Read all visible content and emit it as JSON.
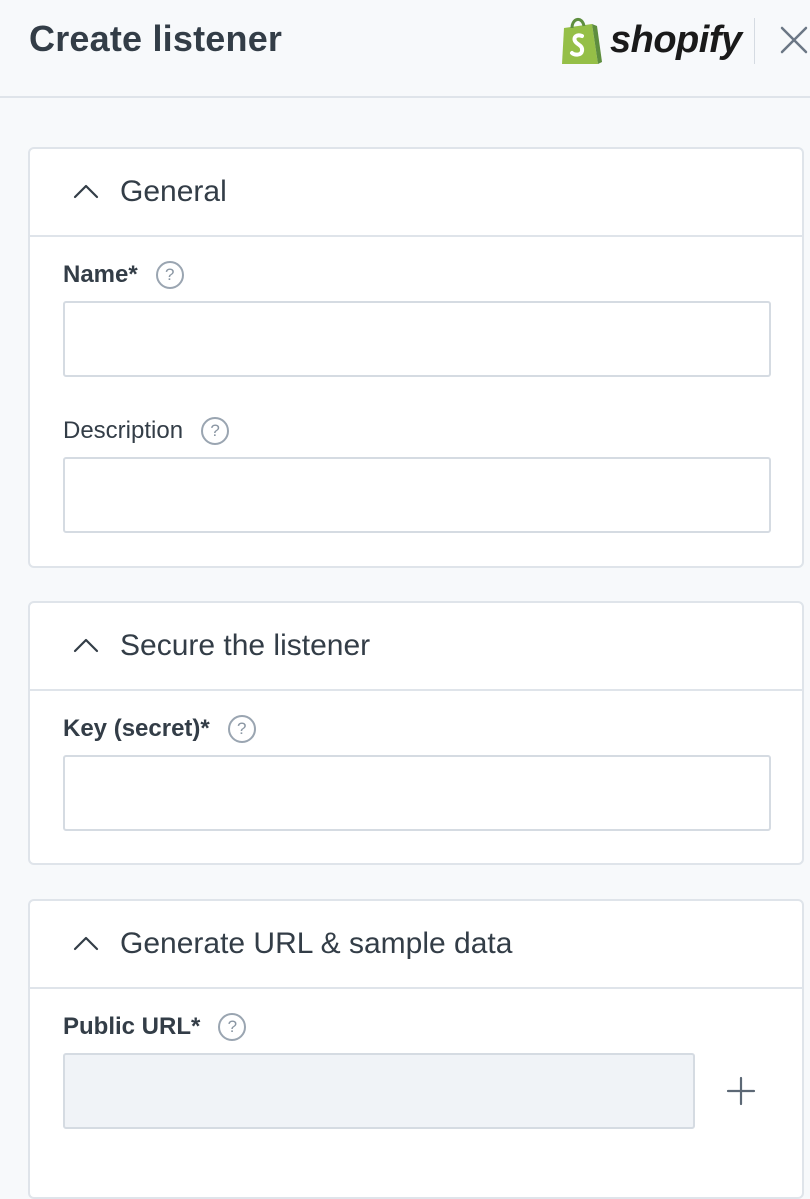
{
  "header": {
    "title": "Create listener",
    "logo_text": "shopify",
    "brand_color": "#95bf47"
  },
  "sections": [
    {
      "title": "General",
      "fields": [
        {
          "label": "Name",
          "required_mark": " *",
          "value": "",
          "placeholder": ""
        },
        {
          "label": "Description",
          "required_mark": "",
          "value": "",
          "placeholder": ""
        }
      ]
    },
    {
      "title": "Secure the listener",
      "fields": [
        {
          "label": "Key (secret)",
          "required_mark": " *",
          "value": "",
          "placeholder": ""
        }
      ]
    },
    {
      "title": "Generate URL & sample data",
      "fields": [
        {
          "label": "Public URL",
          "required_mark": " *",
          "value": "",
          "placeholder": ""
        }
      ]
    }
  ],
  "help_glyph": "?",
  "icons": {
    "close": "close-icon",
    "collapse": "chevron-up-icon",
    "help": "help-icon",
    "add": "plus-icon",
    "logo": "shopify-bag-icon"
  }
}
